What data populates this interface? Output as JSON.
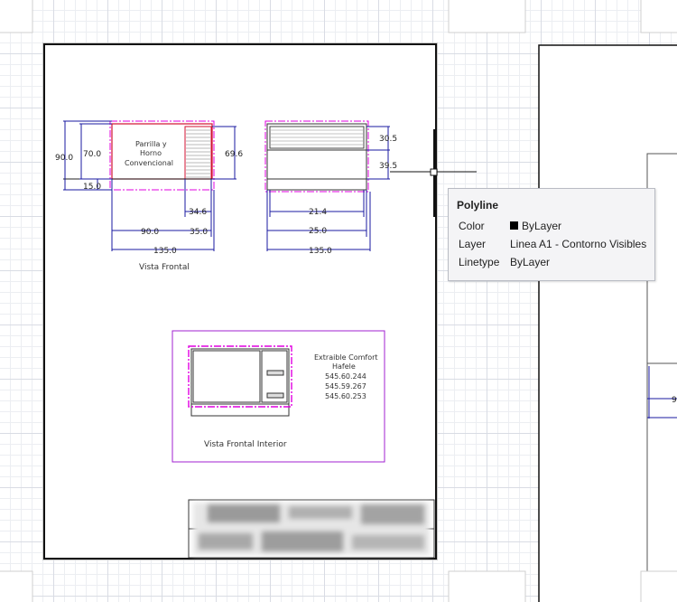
{
  "drawing": {
    "view_frontal_label": "Vista Frontal",
    "view_interior_label": "Vista Frontal Interior",
    "equipment_label_line1": "Parrilla y",
    "equipment_label_line2": "Horno",
    "equipment_label_line3": "Convencional",
    "note_line1": "Extraible Comfort",
    "note_line2": "Hafele",
    "note_line3": "545.60.244",
    "note_line4": "545.59.267",
    "note_line5": "545.60.253",
    "dims": {
      "d90_left": "90.0",
      "d70": "70.0",
      "d15": "15.0",
      "d69_6": "69.6",
      "d34_6": "34.6",
      "d90_bottom": "90.0",
      "d35": "35.0",
      "d135_a": "135.0",
      "d30_5": "30.5",
      "d39_5": "39.5",
      "d21_4": "21.4",
      "d25": "25.0",
      "d135_b": "135.0",
      "d9_partial": "9"
    }
  },
  "tooltip": {
    "title": "Polyline",
    "rows": [
      {
        "label": "Color",
        "value": "ByLayer",
        "swatch": "#000000"
      },
      {
        "label": "Layer",
        "value": "Linea A1 - Contorno Visibles"
      },
      {
        "label": "Linetype",
        "value": "ByLayer"
      }
    ]
  },
  "colors": {
    "dimension": "#1a1aa0",
    "centerline": "#e000e0",
    "highlight": "#d01030",
    "outline": "#333333"
  }
}
